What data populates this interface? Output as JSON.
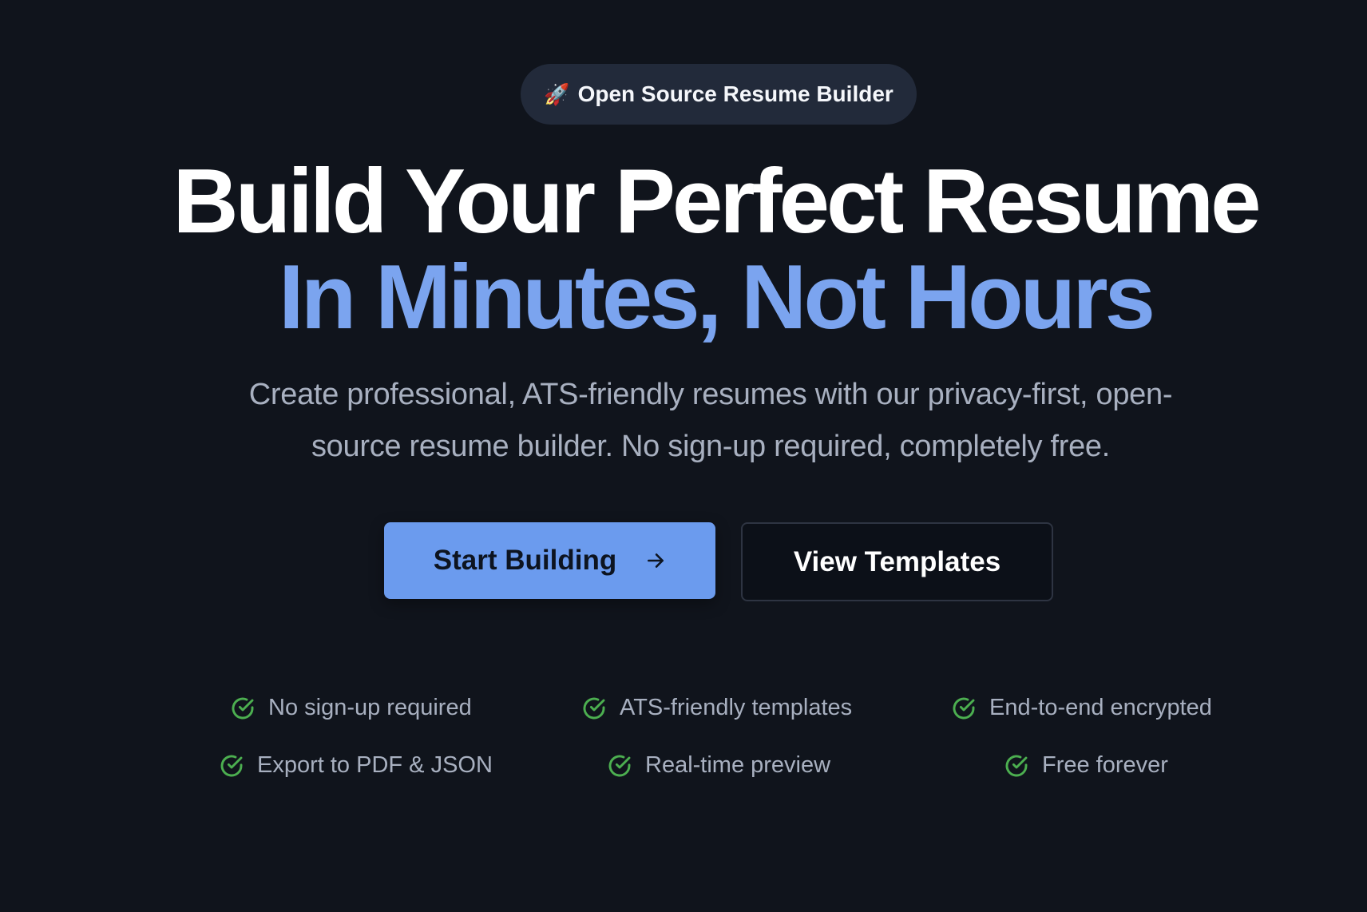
{
  "badge": {
    "icon": "rocket-icon",
    "emoji": "🚀",
    "label": "Open Source Resume Builder"
  },
  "headline": {
    "line1": "Build Your Perfect Resume",
    "line2": "In Minutes, Not Hours"
  },
  "subtitle": "Create professional, ATS-friendly resumes with our privacy-first, open-source resume builder. No sign-up required, completely free.",
  "actions": {
    "primary_label": "Start Building",
    "primary_icon": "arrow-right-icon",
    "secondary_label": "View Templates"
  },
  "features": [
    {
      "label": "No sign-up required",
      "icon": "check-circle-icon"
    },
    {
      "label": "ATS-friendly templates",
      "icon": "check-circle-icon"
    },
    {
      "label": "End-to-end encrypted",
      "icon": "check-circle-icon"
    },
    {
      "label": "Export to PDF & JSON",
      "icon": "check-circle-icon"
    },
    {
      "label": "Real-time preview",
      "icon": "check-circle-icon"
    },
    {
      "label": "Free forever",
      "icon": "check-circle-icon"
    }
  ],
  "colors": {
    "background": "#10141c",
    "accent": "#6b9bee",
    "headline_accent": "#7ba4ef",
    "check": "#4caf50",
    "muted_text": "#a8b0c0"
  }
}
